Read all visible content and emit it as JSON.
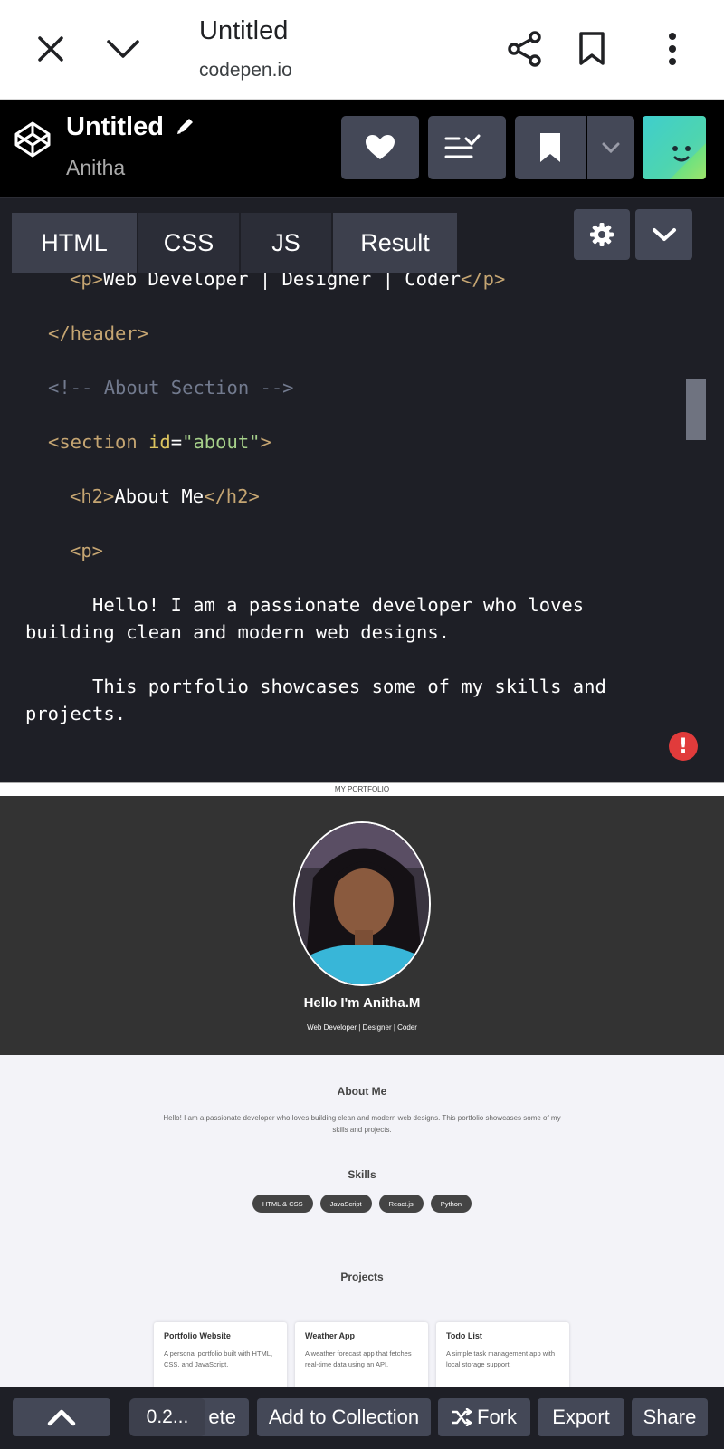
{
  "browser": {
    "title": "Untitled",
    "url": "codepen.io"
  },
  "pen": {
    "title": "Untitled",
    "author": "Anitha"
  },
  "tabs": [
    "HTML",
    "CSS",
    "JS",
    "Result"
  ],
  "code": {
    "l1_open": "<p>",
    "l1_text": "Web Developer | Designer | Coder",
    "l1_close": "</p>",
    "l2": "</header>",
    "l3": "<!-- About Section -->",
    "l4_open": "<section ",
    "l4_attr": "id",
    "l4_eq": "=",
    "l4_val": "\"about\"",
    "l4_close": ">",
    "l5_open": "<h2>",
    "l5_text": "About Me",
    "l5_close": "</h2>",
    "l6": "<p>",
    "l7": "      Hello! I am a passionate developer who loves",
    "l8": "building clean and modern web designs.",
    "l9": "      This portfolio showcases some of my skills and",
    "l10": "projects."
  },
  "preview": {
    "page_title": "MY PORTFOLIO",
    "hero_name": "Hello I'm Anitha.M",
    "hero_sub": "Web Developer | Designer | Coder",
    "about_title": "About Me",
    "about_text": "Hello! I am a passionate developer who loves building clean and modern web designs. This portfolio showcases some of my skills and projects.",
    "skills_title": "Skills",
    "skills": [
      "HTML & CSS",
      "JavaScript",
      "React.js",
      "Python"
    ],
    "projects_title": "Projects",
    "projects": [
      {
        "title": "Portfolio Website",
        "desc": "A personal portfolio built with HTML, CSS, and JavaScript."
      },
      {
        "title": "Weather App",
        "desc": "A weather forecast app that fetches real-time data using an API."
      },
      {
        "title": "Todo List",
        "desc": "A simple task management app with local storage support."
      }
    ]
  },
  "bottombar": {
    "zoom": "0.2...",
    "delete_partial": "ete",
    "add_collection": "Add to Collection",
    "fork": "Fork",
    "export": "Export",
    "share": "Share"
  }
}
